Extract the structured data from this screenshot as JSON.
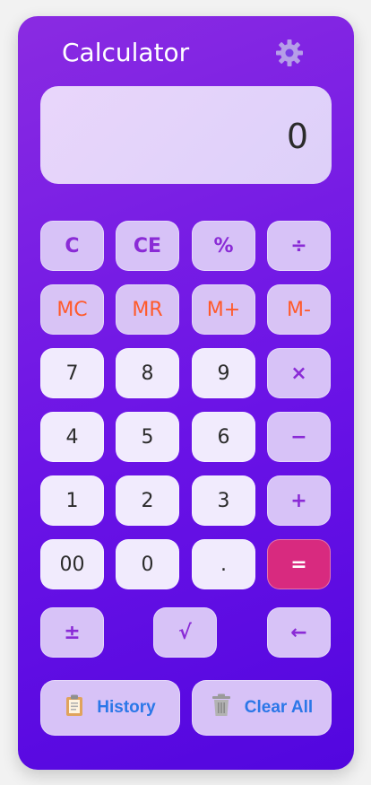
{
  "app": {
    "title": "Calculator",
    "display_value": "0"
  },
  "icons": {
    "settings": "gear-icon",
    "history": "clipboard-icon",
    "clear_all": "trash-icon"
  },
  "colors": {
    "gradient_start": "#8a2be2",
    "gradient_end": "#5206df",
    "function_text": "#8a2bd6",
    "memory_text": "#ff5a2a",
    "equals_bg": "#d82a7f",
    "action_text": "#2b77e8"
  },
  "keys": {
    "clear": "C",
    "clear_entry": "CE",
    "percent": "%",
    "divide": "÷",
    "mc": "MC",
    "mr": "MR",
    "m_plus": "M+",
    "m_minus": "M-",
    "seven": "7",
    "eight": "8",
    "nine": "9",
    "multiply": "×",
    "four": "4",
    "five": "5",
    "six": "6",
    "minus": "−",
    "one": "1",
    "two": "2",
    "three": "3",
    "plus": "+",
    "double_zero": "00",
    "zero": "0",
    "decimal": ".",
    "equals": "=",
    "plus_minus": "±",
    "sqrt": "√",
    "backspace": "←"
  },
  "actions": {
    "history": "History",
    "clear_all": "Clear All"
  }
}
